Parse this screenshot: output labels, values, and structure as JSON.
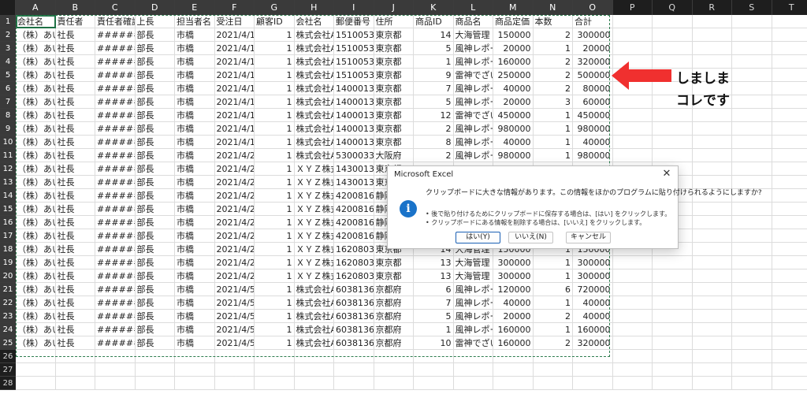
{
  "columns": [
    "A",
    "B",
    "C",
    "D",
    "E",
    "F",
    "G",
    "H",
    "I",
    "J",
    "K",
    "L",
    "M",
    "N",
    "O",
    "P",
    "Q",
    "R",
    "S",
    "T"
  ],
  "active_cell": "A1",
  "headers": [
    "会社名",
    "責任者",
    "責任者確認",
    "上長",
    "担当者名",
    "受注日",
    "顧客ID",
    "会社名",
    "郵便番号",
    "住所",
    "商品ID",
    "商品名",
    "商品定価",
    "本数",
    "合計"
  ],
  "rows": [
    [
      "（株）あい",
      "社長",
      "#######",
      "部長",
      "市橋",
      "2021/4/1",
      "1",
      "株式会社A",
      "1510053",
      "東京都",
      "14",
      "大海管理",
      "150000",
      "2",
      "300000"
    ],
    [
      "（株）あい",
      "社長",
      "#######",
      "部長",
      "市橋",
      "2021/4/1",
      "1",
      "株式会社A",
      "1510053",
      "東京都",
      "5",
      "風神レポー",
      "20000",
      "1",
      "20000"
    ],
    [
      "（株）あい",
      "社長",
      "#######",
      "部長",
      "市橋",
      "2021/4/1",
      "1",
      "株式会社A",
      "1510053",
      "東京都",
      "1",
      "風神レポー",
      "160000",
      "2",
      "320000"
    ],
    [
      "（株）あい",
      "社長",
      "#######",
      "部長",
      "市橋",
      "2021/4/1",
      "1",
      "株式会社A",
      "1510053",
      "東京都",
      "9",
      "雷神でざい",
      "250000",
      "2",
      "500000"
    ],
    [
      "（株）あい",
      "社長",
      "#######",
      "部長",
      "市橋",
      "2021/4/1",
      "1",
      "株式会社A",
      "1400013",
      "東京都",
      "7",
      "風神レポー",
      "40000",
      "2",
      "80000"
    ],
    [
      "（株）あい",
      "社長",
      "#######",
      "部長",
      "市橋",
      "2021/4/1",
      "1",
      "株式会社A",
      "1400013",
      "東京都",
      "5",
      "風神レポー",
      "20000",
      "3",
      "60000"
    ],
    [
      "（株）あい",
      "社長",
      "#######",
      "部長",
      "市橋",
      "2021/4/1",
      "1",
      "株式会社A",
      "1400013",
      "東京都",
      "12",
      "雷神でざい",
      "450000",
      "1",
      "450000"
    ],
    [
      "（株）あい",
      "社長",
      "#######",
      "部長",
      "市橋",
      "2021/4/1",
      "1",
      "株式会社A",
      "1400013",
      "東京都",
      "2",
      "風神レポー",
      "980000",
      "1",
      "980000"
    ],
    [
      "（株）あい",
      "社長",
      "#######",
      "部長",
      "市橋",
      "2021/4/1",
      "1",
      "株式会社A",
      "1400013",
      "東京都",
      "8",
      "風神レポー",
      "40000",
      "1",
      "40000"
    ],
    [
      "（株）あい",
      "社長",
      "#######",
      "部長",
      "市橋",
      "2021/4/2",
      "1",
      "株式会社A",
      "5300033",
      "大阪府",
      "2",
      "風神レポー",
      "980000",
      "1",
      "980000"
    ],
    [
      "（株）あい",
      "社長",
      "#######",
      "部長",
      "市橋",
      "2021/4/2",
      "1",
      "ＸＹＺ株式",
      "1430013",
      "東京都",
      "",
      "",
      "",
      "",
      ""
    ],
    [
      "（株）あい",
      "社長",
      "#######",
      "部長",
      "市橋",
      "2021/4/2",
      "1",
      "ＸＹＺ株式",
      "1430013",
      "東京都",
      "",
      "",
      "",
      "",
      ""
    ],
    [
      "（株）あい",
      "社長",
      "#######",
      "部長",
      "市橋",
      "2021/4/2",
      "1",
      "ＸＹＺ株式",
      "4200816",
      "静岡",
      "",
      "",
      "",
      "",
      ""
    ],
    [
      "（株）あい",
      "社長",
      "#######",
      "部長",
      "市橋",
      "2021/4/2",
      "1",
      "ＸＹＺ株式",
      "4200816",
      "静岡",
      "",
      "",
      "",
      "",
      ""
    ],
    [
      "（株）あい",
      "社長",
      "#######",
      "部長",
      "市橋",
      "2021/4/2",
      "1",
      "ＸＹＺ株式",
      "4200816",
      "静岡",
      "",
      "",
      "",
      "",
      ""
    ],
    [
      "（株）あい",
      "社長",
      "#######",
      "部長",
      "市橋",
      "2021/4/2",
      "1",
      "ＸＹＺ株式",
      "4200816",
      "静岡",
      "",
      "",
      "",
      "",
      ""
    ],
    [
      "（株）あい",
      "社長",
      "#######",
      "部長",
      "市橋",
      "2021/4/2",
      "1",
      "ＸＹＺ株式",
      "1620803",
      "東京都",
      "14",
      "大海管理",
      "150000",
      "1",
      "150000"
    ],
    [
      "（株）あい",
      "社長",
      "#######",
      "部長",
      "市橋",
      "2021/4/2",
      "1",
      "ＸＹＺ株式",
      "1620803",
      "東京都",
      "13",
      "大海管理",
      "300000",
      "1",
      "300000"
    ],
    [
      "（株）あい",
      "社長",
      "#######",
      "部長",
      "市橋",
      "2021/4/2",
      "1",
      "ＸＹＺ株式",
      "1620803",
      "東京都",
      "13",
      "大海管理",
      "300000",
      "1",
      "300000"
    ],
    [
      "（株）あい",
      "社長",
      "#######",
      "部長",
      "市橋",
      "2021/4/5",
      "1",
      "株式会社A",
      "6038136",
      "京都府",
      "6",
      "風神レポー",
      "120000",
      "6",
      "720000"
    ],
    [
      "（株）あい",
      "社長",
      "#######",
      "部長",
      "市橋",
      "2021/4/5",
      "1",
      "株式会社A",
      "6038136",
      "京都府",
      "7",
      "風神レポー",
      "40000",
      "1",
      "40000"
    ],
    [
      "（株）あい",
      "社長",
      "#######",
      "部長",
      "市橋",
      "2021/4/5",
      "1",
      "株式会社A",
      "6038136",
      "京都府",
      "5",
      "風神レポー",
      "20000",
      "2",
      "40000"
    ],
    [
      "（株）あい",
      "社長",
      "#######",
      "部長",
      "市橋",
      "2021/4/5",
      "1",
      "株式会社A",
      "6038136",
      "京都府",
      "1",
      "風神レポー",
      "160000",
      "1",
      "160000"
    ],
    [
      "（株）あい",
      "社長",
      "#######",
      "部長",
      "市橋",
      "2021/4/5",
      "1",
      "株式会社A",
      "6038136",
      "京都府",
      "10",
      "雷神でざい",
      "160000",
      "2",
      "320000"
    ]
  ],
  "total_rows": 28,
  "callout": {
    "text": "しましま\nコレです",
    "arrow_color": "#f0302f"
  },
  "dialog": {
    "title": "Microsoft Excel",
    "close": "✕",
    "icon": "i",
    "message": "クリップボードに大きな情報があります。この情報をほかのプログラムに貼り付けられるようにしますか?",
    "bullet1": "• 後で貼り付けるためにクリップボードに保存する場合は、[はい] をクリックします。",
    "bullet2": "• クリップボードにある情報を削除する場合は、[いいえ] をクリックします。",
    "yes": "はい(Y)",
    "no": "いいえ(N)",
    "cancel": "キャンセル"
  },
  "colors": {
    "header_bg": "#1e1e1e",
    "marquee": "#2e7d4f",
    "info_icon": "#1a73c9"
  }
}
